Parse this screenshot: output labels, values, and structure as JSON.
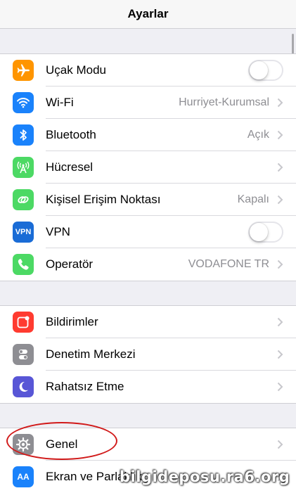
{
  "nav": {
    "title": "Ayarlar"
  },
  "groups": {
    "network": [
      {
        "label": "Uçak Modu",
        "icon": "airplane-icon",
        "color": "#ff9500",
        "toggle": false
      },
      {
        "label": "Wi-Fi",
        "value": "Hurriyet-Kurumsal",
        "icon": "wifi-icon",
        "color": "#1a82fb"
      },
      {
        "label": "Bluetooth",
        "value": "Açık",
        "icon": "bluetooth-icon",
        "color": "#1a82fb"
      },
      {
        "label": "Hücresel",
        "icon": "cellular-icon",
        "color": "#4cd964"
      },
      {
        "label": "Kişisel Erişim Noktası",
        "value": "Kapalı",
        "icon": "hotspot-icon",
        "color": "#4cd964"
      },
      {
        "label": "VPN",
        "icon": "vpn-icon",
        "icon_text": "VPN",
        "color": "#1a6cd6",
        "toggle": false
      },
      {
        "label": "Operatör",
        "value": "VODAFONE TR",
        "icon": "phone-icon",
        "color": "#4cd964"
      }
    ],
    "notifications": [
      {
        "label": "Bildirimler",
        "icon": "notifications-icon",
        "color": "#ff3b30"
      },
      {
        "label": "Denetim Merkezi",
        "icon": "control-center-icon",
        "color": "#8e8e93"
      },
      {
        "label": "Rahatsız Etme",
        "icon": "moon-icon",
        "color": "#5856d6"
      }
    ],
    "general": [
      {
        "label": "Genel",
        "icon": "gear-icon",
        "color": "#8e8e93"
      },
      {
        "label": "Ekran ve Parlaklık",
        "icon": "display-icon",
        "icon_text": "AA",
        "color": "#1a82fb"
      }
    ]
  },
  "watermark": "bilgideposu.ra6.org"
}
